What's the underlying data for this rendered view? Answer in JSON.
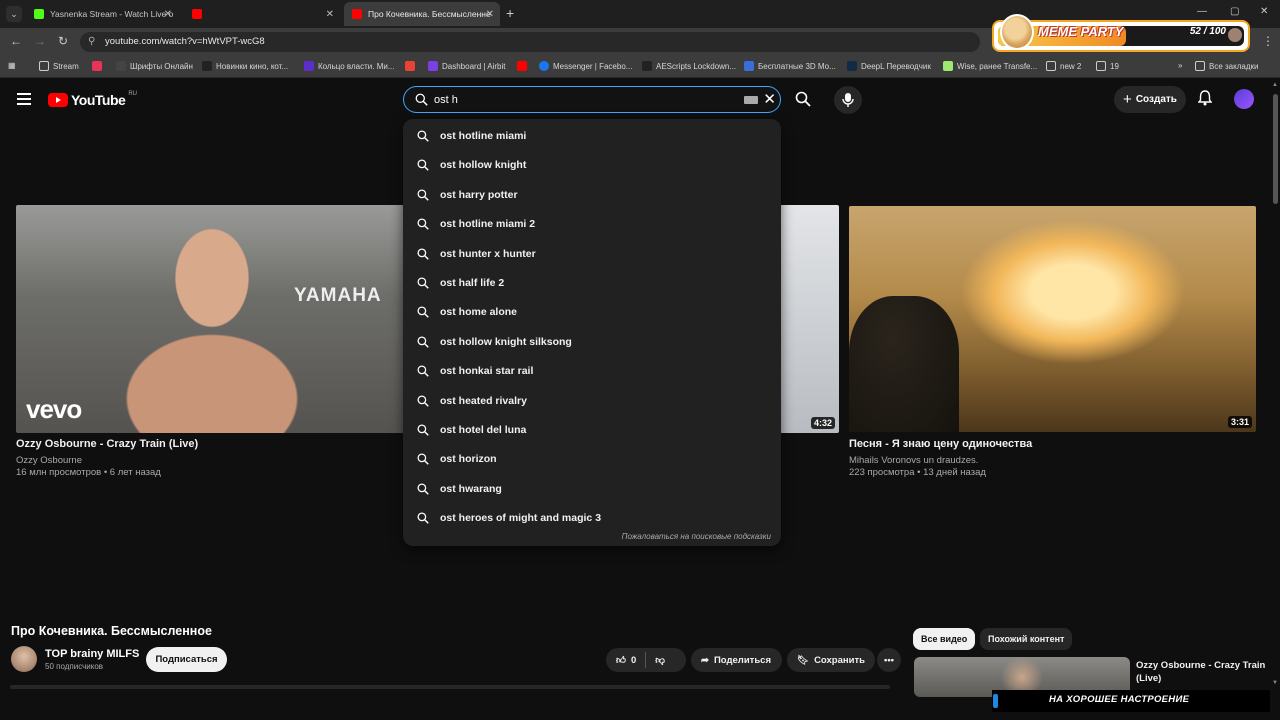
{
  "browser": {
    "tabs": [
      {
        "label": "Yasnenka Stream - Watch Live o",
        "favicon_color": "#53fc18"
      },
      {
        "label": "",
        "favicon_color": "#ff0000"
      },
      {
        "label": "Про Кочевника. Бессмыслeнне",
        "favicon_color": "#ff0000"
      }
    ],
    "url": "youtube.com/watch?v=hWtVPT-wcG8",
    "bookmarks": [
      {
        "label": "Stream",
        "icon": "folder-icon"
      },
      {
        "label": "",
        "icon": "mailru-icon"
      },
      {
        "label": "Шрифты Онлайн",
        "icon": "font-icon"
      },
      {
        "label": "Новинки кино, кот...",
        "icon": "film-icon"
      },
      {
        "label": "Кольцо власти. Ми...",
        "icon": "ring-icon"
      },
      {
        "label": "",
        "icon": "gmail-icon"
      },
      {
        "label": "Dashboard | Airbit",
        "icon": "airbit-icon"
      },
      {
        "label": "",
        "icon": "youtube-icon"
      },
      {
        "label": "Messenger | Facebo...",
        "icon": "facebook-icon"
      },
      {
        "label": "AEScripts Lockdown...",
        "icon": "aescripts-icon"
      },
      {
        "label": "Бесплатные 3D Мо...",
        "icon": "3d-icon"
      },
      {
        "label": "DeepL Переводчик",
        "icon": "deepl-icon"
      },
      {
        "label": "Wise, ранее Transfe...",
        "icon": "wise-icon"
      },
      {
        "label": "new 2",
        "icon": "folder-icon"
      },
      {
        "label": "19",
        "icon": "folder-icon"
      }
    ],
    "all_bookmarks": "Все закладки"
  },
  "overlay": {
    "title": "MEME PARTY",
    "count": "52 / 100",
    "progress": 0.52
  },
  "youtube": {
    "logo_text": "YouTube",
    "region": "RU",
    "search": {
      "query": "ost h"
    },
    "create_label": "Создать",
    "suggestions": [
      "ost hotline miami",
      "ost hollow knight",
      "ost harry potter",
      "ost hotline miami 2",
      "ost hunter x hunter",
      "ost half life 2",
      "ost home alone",
      "ost hollow knight silksong",
      "ost honkai star rail",
      "ost heated rivalry",
      "ost hotel del luna",
      "ost horizon",
      "ost hwarang",
      "ost heroes of might and magic 3"
    ],
    "report_label": "Пожаловаться на поисковые подсказки",
    "videos": [
      {
        "title": "Ozzy Osbourne - Crazy Train (Live)",
        "channel": "Ozzy Osbourne",
        "meta": "16 млн просмотров • 6 лет назад",
        "badge": "vevo",
        "stage_text": "YAMAHA"
      },
      {
        "duration": "4:32"
      },
      {
        "title": "Песня - Я знаю цену одиночества",
        "channel": "Mihails Voronovs un draudzes.",
        "meta": "223 просмотра • 13 дней назад",
        "duration": "3:31"
      }
    ],
    "current": {
      "title": "Про Кочевника. Бессмысленное",
      "channel": "TOP brainy MILFS",
      "subscribers": "50 подписчиков",
      "subscribe_label": "Подписаться",
      "likes": "0",
      "share_label": "Поделиться",
      "save_label": "Сохранить"
    },
    "chips": [
      "Все видео",
      "Похожий контент"
    ],
    "recommended": {
      "title": "Ozzy Osbourne - Crazy Train (Live)"
    }
  },
  "stream_banner": "НА ХОРОШЕЕ НАСТРОЕНИЕ"
}
